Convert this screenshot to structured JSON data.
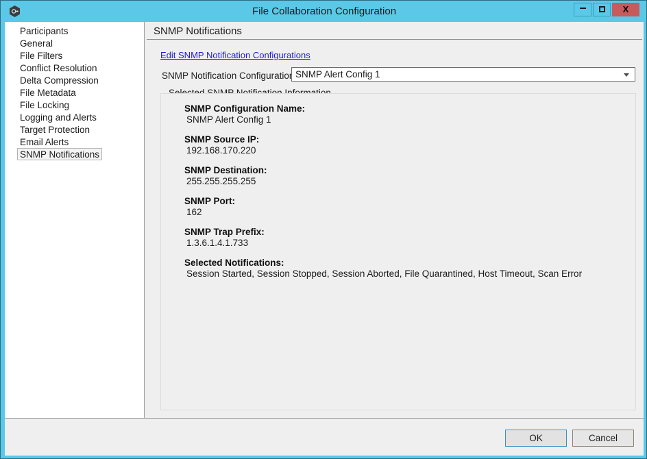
{
  "window": {
    "title": "File Collaboration Configuration",
    "app_icon": "hexagon-app-icon",
    "controls": {
      "minimize_label": "Minimize",
      "maximize_label": "Maximize",
      "close_label": "X"
    }
  },
  "sidebar": {
    "items": [
      {
        "label": "Participants",
        "selected": false
      },
      {
        "label": "General",
        "selected": false
      },
      {
        "label": "File Filters",
        "selected": false
      },
      {
        "label": "Conflict Resolution",
        "selected": false
      },
      {
        "label": "Delta Compression",
        "selected": false
      },
      {
        "label": "File Metadata",
        "selected": false
      },
      {
        "label": "File Locking",
        "selected": false
      },
      {
        "label": "Logging and Alerts",
        "selected": false
      },
      {
        "label": "Target Protection",
        "selected": false
      },
      {
        "label": "Email Alerts",
        "selected": false
      },
      {
        "label": "SNMP Notifications",
        "selected": true
      }
    ]
  },
  "content": {
    "title": "SNMP Notifications",
    "edit_link": "Edit SNMP Notification Configurations",
    "combo_label": "SNMP Notification Configuration:",
    "combo_value": "SNMP Alert Config 1",
    "group_legend": "Selected SNMP Notification Information",
    "fields": [
      {
        "label": "SNMP Configuration Name:",
        "value": "SNMP Alert Config 1"
      },
      {
        "label": "SNMP Source IP:",
        "value": "192.168.170.220"
      },
      {
        "label": "SNMP Destination:",
        "value": "255.255.255.255"
      },
      {
        "label": "SNMP Port:",
        "value": "162"
      },
      {
        "label": "SNMP Trap Prefix:",
        "value": "1.3.6.1.4.1.733"
      },
      {
        "label": "Selected Notifications:",
        "value": "Session Started, Session Stopped, Session Aborted, File Quarantined, Host Timeout, Scan Error"
      }
    ]
  },
  "buttons": {
    "ok_label": "OK",
    "cancel_label": "Cancel"
  },
  "colors": {
    "titlebar": "#5bc8e8",
    "close_button": "#c75b5b",
    "link": "#1a1ae0",
    "panel": "#efefef",
    "list_background": "#ffffff",
    "ok_focus_border": "#3b8fbf"
  }
}
